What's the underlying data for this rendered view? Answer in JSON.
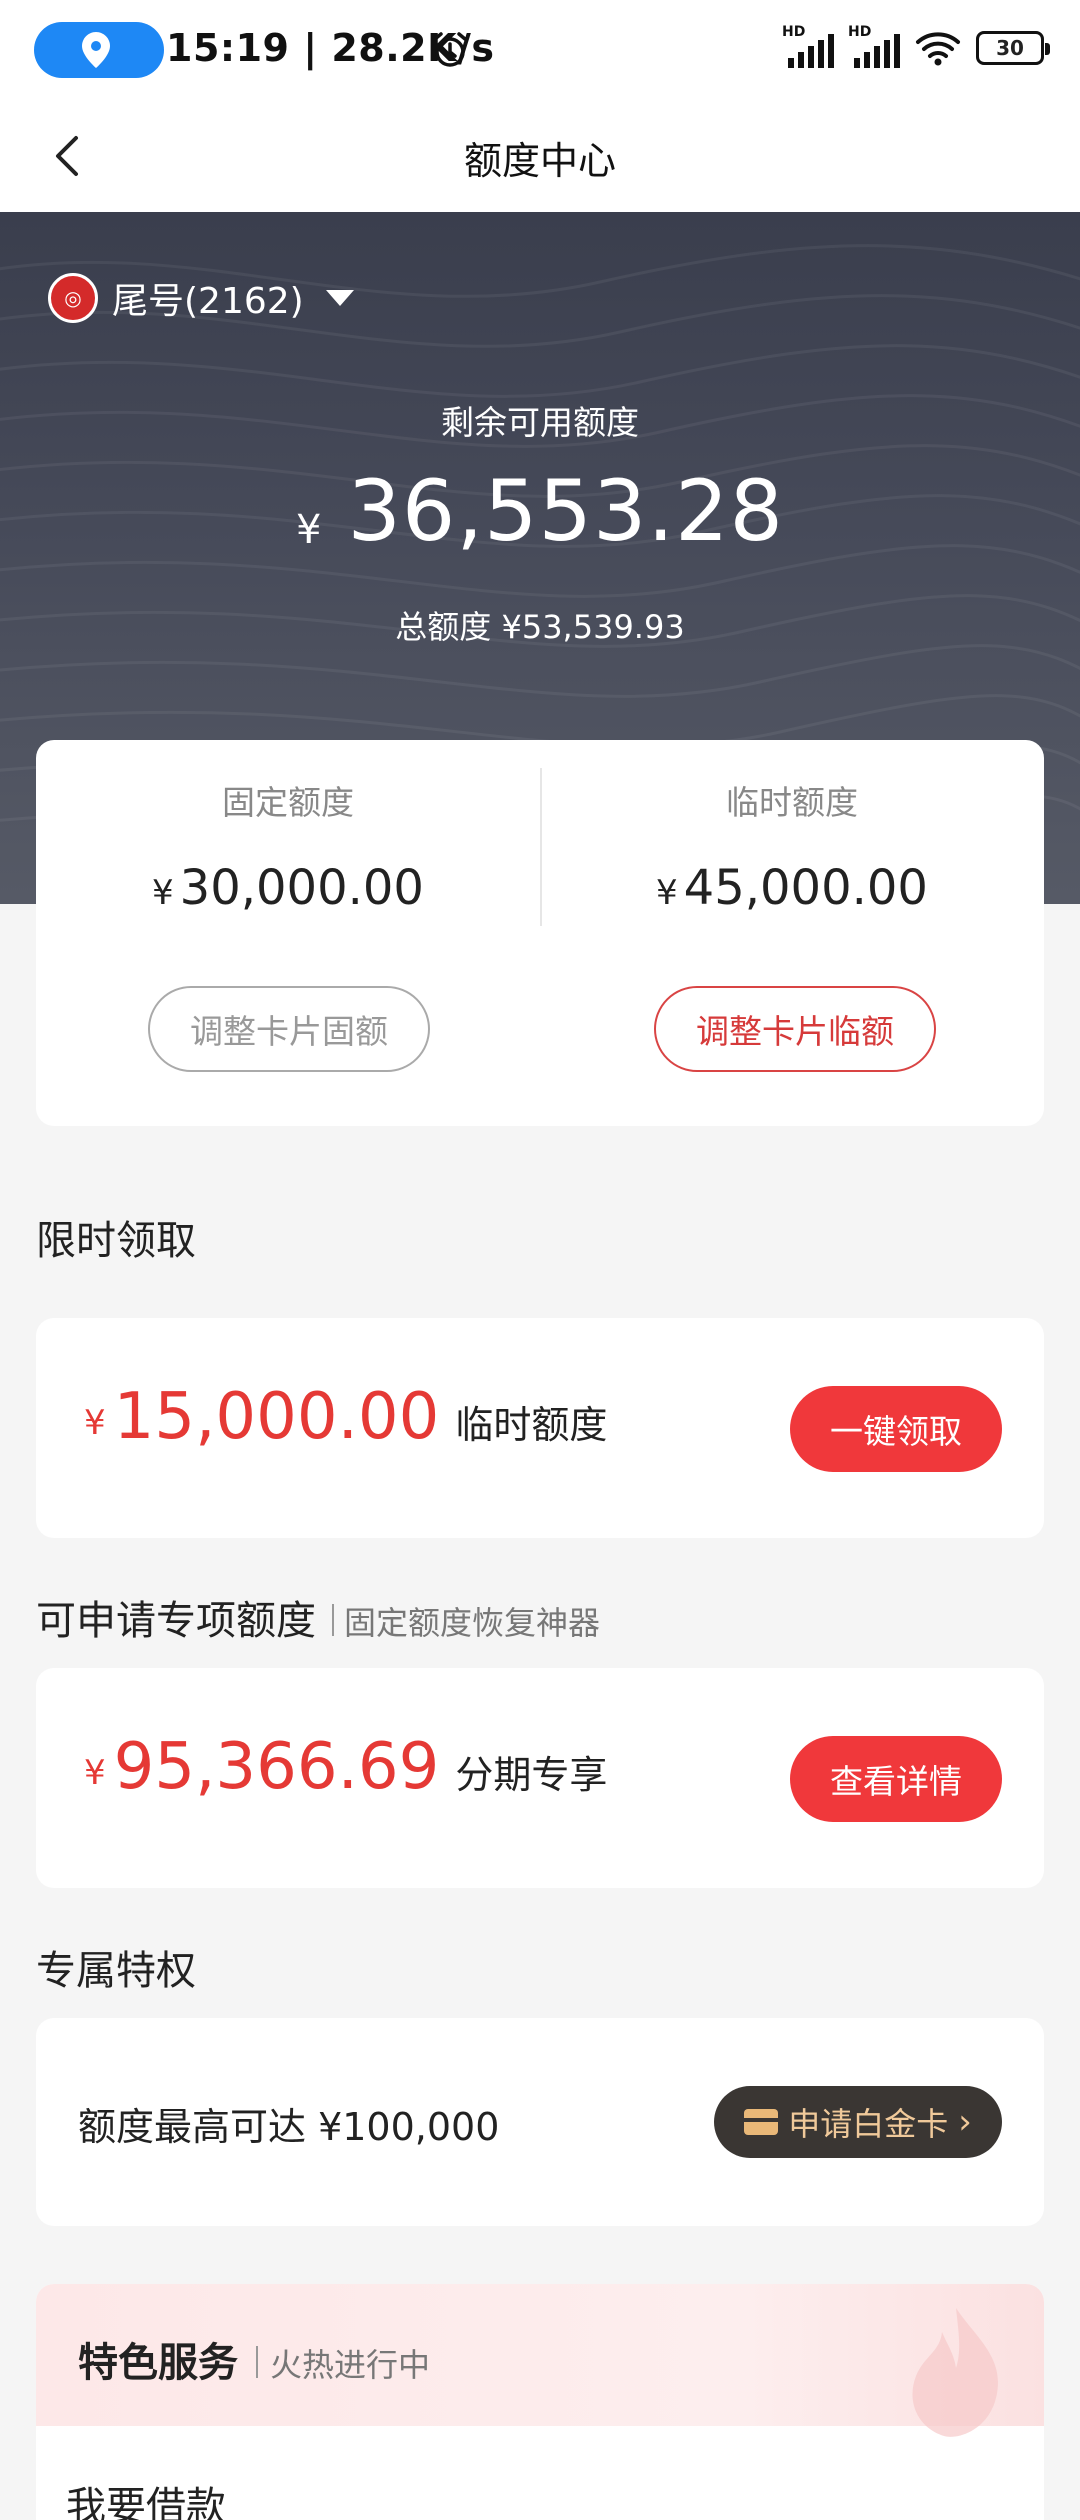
{
  "status_bar": {
    "time": "15:19",
    "speed": "28.2K/s",
    "network_1": "HD",
    "network_2": "HD",
    "battery": "30"
  },
  "nav": {
    "title": "额度中心"
  },
  "hero": {
    "card_label": "尾号(2162)",
    "remaining_label": "剩余可用额度",
    "currency": "¥",
    "remaining_amount": "36,553.28",
    "total_label": "总额度 ¥53,539.93"
  },
  "quota": {
    "fixed_label": "固定额度",
    "fixed_amount": "30,000.00",
    "fixed_button": "调整卡片固额",
    "temp_label": "临时额度",
    "temp_amount": "45,000.00",
    "temp_button": "调整卡片临额"
  },
  "limited": {
    "section_title": "限时领取",
    "amount": "15,000.00",
    "desc": "临时额度",
    "button": "一键领取"
  },
  "special": {
    "section_title": "可申请专项额度",
    "section_sub": "固定额度恢复神器",
    "amount": "95,366.69",
    "desc": "分期专享",
    "button": "查看详情"
  },
  "privilege": {
    "section_title": "专属特权",
    "text": "额度最高可达 ¥100,000",
    "button": "申请白金卡"
  },
  "feature": {
    "title": "特色服务",
    "sub": "火热进行中",
    "loan": "我要借款"
  },
  "colors": {
    "accent_red": "#f0383b",
    "amount_red": "#e53935",
    "hero_bg": "#464a59",
    "status_pill": "#1e88f5"
  }
}
